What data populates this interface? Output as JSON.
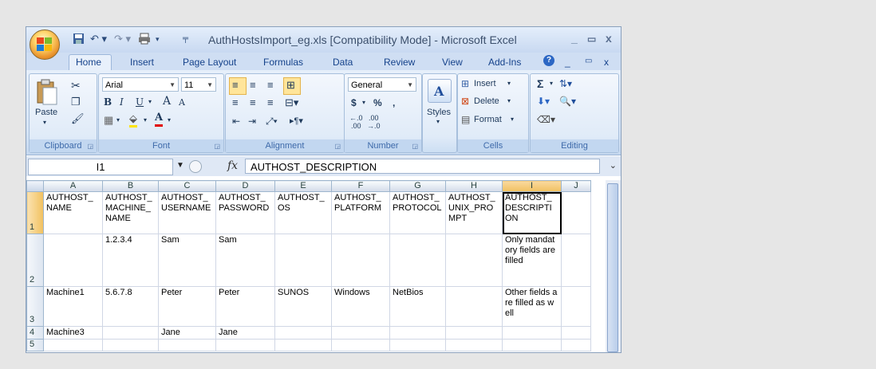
{
  "window": {
    "title": "AuthHostsImport_eg.xls  [Compatibility Mode] - Microsoft Excel",
    "controls": {
      "minimize": "_",
      "restore": "▭",
      "close": "x"
    },
    "app_controls": {
      "help": "?",
      "minimize": "_",
      "restore": "▭",
      "close": "x"
    }
  },
  "ribbon_tabs": [
    "Home",
    "Insert",
    "Page Layout",
    "Formulas",
    "Data",
    "Review",
    "View",
    "Add-Ins"
  ],
  "ribbon": {
    "clipboard": {
      "label": "Clipboard",
      "paste": "Paste"
    },
    "font": {
      "label": "Font",
      "font_name": "Arial",
      "font_size": "11",
      "bold": "B",
      "italic": "I",
      "underline": "U",
      "grow": "A",
      "shrink": "A",
      "font_color": "A"
    },
    "alignment": {
      "label": "Alignment"
    },
    "number": {
      "label": "Number",
      "format": "General",
      "currency": "$",
      "percent": "%",
      "comma": ","
    },
    "styles": {
      "label": "Styles"
    },
    "cells": {
      "label": "Cells",
      "insert": "Insert",
      "delete": "Delete",
      "format": "Format"
    },
    "editing": {
      "label": "Editing",
      "sum": "Σ"
    }
  },
  "formula_bar": {
    "name_box": "I1",
    "fx": "fx",
    "formula": "AUTHOST_DESCRIPTION"
  },
  "grid": {
    "columns": [
      "A",
      "B",
      "C",
      "D",
      "E",
      "F",
      "G",
      "H",
      "I",
      "J"
    ],
    "selected_column": "I",
    "rows": [
      {
        "num": "1",
        "cells": [
          "AUTHOST_ NAME",
          "AUTHOST_ MACHINE_ NAME",
          "AUTHOST_ USERNAME",
          "AUTHOST_ PASSWORD",
          "AUTHOST_ OS",
          "AUTHOST_ PLATFORM",
          "AUTHOST_ PROTOCOL",
          "AUTHOST_ UNIX_PROMPT",
          "AUTHOST_ DESCRIPTION",
          ""
        ]
      },
      {
        "num": "2",
        "cells": [
          "",
          "1.2.3.4",
          "Sam",
          "Sam",
          "",
          "",
          "",
          "",
          "Only mandatory fields are filled",
          ""
        ]
      },
      {
        "num": "3",
        "cells": [
          "Machine1",
          "5.6.7.8",
          "Peter",
          "Peter",
          "SUNOS",
          "Windows",
          "NetBios",
          "",
          "Other fields are filled as well",
          ""
        ]
      },
      {
        "num": "4",
        "cells": [
          "Machine3",
          "",
          "Jane",
          "Jane",
          "",
          "",
          "",
          "",
          "",
          ""
        ]
      },
      {
        "num": "5",
        "cells": [
          "",
          "",
          "",
          "",
          "",
          "",
          "",
          "",
          "",
          ""
        ]
      }
    ]
  },
  "icons": [
    "office-button-icon",
    "save-icon",
    "undo-icon",
    "redo-icon",
    "print-icon",
    "paste-icon",
    "cut-icon",
    "copy-icon",
    "format-painter-icon"
  ]
}
